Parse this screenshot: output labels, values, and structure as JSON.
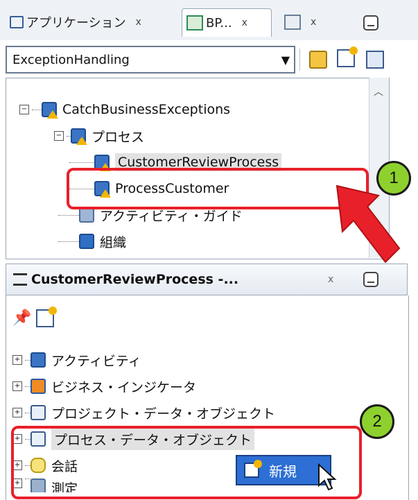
{
  "tabs": [
    {
      "label": "アプリケーション",
      "close": "x"
    },
    {
      "label": "BP...",
      "close": "x"
    },
    {
      "label": "",
      "close": "x"
    }
  ],
  "combo": {
    "value": "ExceptionHandling"
  },
  "tree": [
    {
      "label": "CatchBusinessExceptions",
      "level": 0,
      "expander": "minus",
      "icon": "project-icon"
    },
    {
      "label": "プロセス",
      "level": 1,
      "expander": "minus",
      "icon": "process-folder-icon"
    },
    {
      "label": "CustomerReviewProcess",
      "level": 2,
      "icon": "process-icon",
      "selected": true
    },
    {
      "label": "ProcessCustomer",
      "level": 2,
      "icon": "process-icon"
    },
    {
      "label": "アクティビティ・ガイド",
      "level": 1,
      "icon": "activity-guide-icon"
    },
    {
      "label": "組織",
      "level": 1,
      "icon": "organization-icon"
    }
  ],
  "panel2": {
    "title": "CustomerReviewProcess -...",
    "close": "x",
    "items": [
      {
        "label": "アクティビティ",
        "icon": "activity-icon"
      },
      {
        "label": "ビジネス・インジケータ",
        "icon": "business-indicator-icon"
      },
      {
        "label": "プロジェクト・データ・オブジェクト",
        "icon": "data-object-icon"
      },
      {
        "label": "プロセス・データ・オブジェクト",
        "icon": "data-object-icon",
        "selected": true
      },
      {
        "label": "会話",
        "icon": "conversation-icon"
      },
      {
        "label": "測定",
        "icon": "measure-icon"
      }
    ]
  },
  "context_menu": {
    "new_label": "新規"
  },
  "callouts": {
    "one": "1",
    "two": "2"
  },
  "colors": {
    "highlight_red": "#e8202a",
    "callout_green": "#8ed12e",
    "menu_blue": "#2d6fd4"
  }
}
